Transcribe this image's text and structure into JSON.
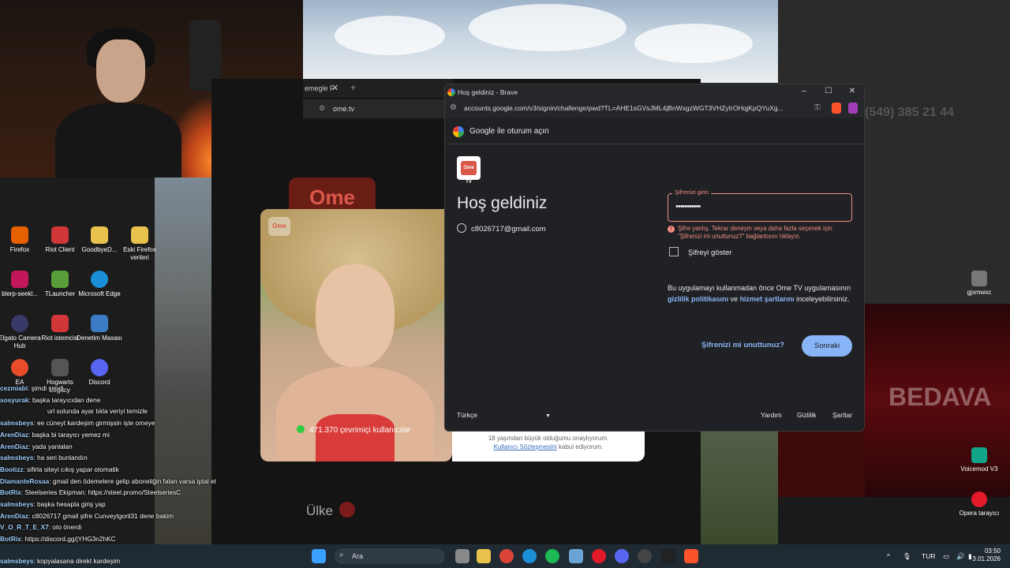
{
  "browser_window": {
    "title": "Hoş geldiniz - Brave",
    "url": "accounts.google.com/v3/signin/challenge/pwd?TL=AHE1sGVsJML4jBnWxgzWGT3VHZyIrOHqjKpQYuXg...",
    "header": "Google ile oturum açın"
  },
  "signin": {
    "app_badge": "Ome TV",
    "heading": "Hoş geldiniz",
    "account_email": "c8026717@gmail.com",
    "password_label": "Şifrenizi girin",
    "password_value": "•••••••••••",
    "error_text": "Şifre yanlış. Tekrar deneyin veya daha fazla seçenek için \"Şifrenizi mi unuttunuz?\" bağlantısını tıklayın.",
    "show_password_label": "Şifreyi göster",
    "policy_text_prefix": "Bu uygulamayı kullanmadan önce Ome TV uygulamasının",
    "privacy_link": "gizlilik politikasını",
    "and_word": "ve",
    "terms_link": "hizmet şartlarını",
    "policy_text_suffix": "inceleyebilirsiniz.",
    "forgot_link": "Şifrenizi mi unuttunuz?",
    "next_button": "Sonraki",
    "language": "Türkçe",
    "footer_help": "Yardım",
    "footer_privacy": "Gizlilik",
    "footer_terms": "Şartlar"
  },
  "ome_page": {
    "logo": "Ome",
    "tab_label": "emegle F",
    "url": "ome.tv",
    "online_count": "471.370 çevrimiçi kullanıcılar",
    "age_text": "18 yaşından büyük olduğumu onaylıyorum.",
    "agreement_link": "Kullanıcı Sözleşmesini",
    "agreement_suffix": "kabul ediyorum.",
    "country_label": "Ülke",
    "video_badge": "Ome"
  },
  "background_page": {
    "phone": "(549) 385 21 44"
  },
  "desktop_icons": [
    {
      "label": "Firefox",
      "color": "#e66000"
    },
    {
      "label": "Riot Client",
      "color": "#d13639"
    },
    {
      "label": "GoodbyeD...",
      "color": "#e8c24a"
    },
    {
      "label": "Eski Firefox verileri",
      "color": "#e8c24a"
    },
    {
      "label": "blerp-seekl...",
      "color": "#c2185b"
    },
    {
      "label": "TLauncher",
      "color": "#5a9e3a"
    },
    {
      "label": "Microsoft Edge",
      "color": "#1a8fd8"
    },
    {
      "label": "Elgato Camera Hub",
      "color": "#3a3a6a"
    },
    {
      "label": "Riot istemcisi",
      "color": "#d13639"
    },
    {
      "label": "Denetim Masası",
      "color": "#3b7dc4"
    },
    {
      "label": "EA",
      "color": "#e84c2b"
    },
    {
      "label": "Hogwarts Legacy",
      "color": "#555555"
    },
    {
      "label": "Discord",
      "color": "#5865f2"
    }
  ],
  "right_icons": [
    {
      "label": "gjxmwxc",
      "color": "#777777"
    },
    {
      "label": "Voicemod V3",
      "color": "#13a58a"
    },
    {
      "label": "Opera tarayıcı",
      "color": "#e21a2a"
    }
  ],
  "chat": [
    {
      "user": "cezmiabi",
      "msg": ": şimdi şimdi"
    },
    {
      "user": "sosyurak",
      "msg": ": başka tarayıcıdan dene"
    },
    {
      "user": "",
      "msg": "url solunda ayar tıkla veriyi temizle"
    },
    {
      "user": "salmsbeys",
      "msg": ": ee cüneyt kardeşim girmişsin işte omeye"
    },
    {
      "user": "ArenDiaz",
      "msg": ": başka bi tarayıcı yemez mi"
    },
    {
      "user": "ArenDiaz",
      "msg": ": yada yanlalan"
    },
    {
      "user": "salmsbeys",
      "msg": ": ha seri bunlandın"
    },
    {
      "user": "Bootizz",
      "msg": ": sifirla siteyi cıkış yapar otomatik"
    },
    {
      "user": "DiamanteRosaa",
      "msg": ": gmail den ödemelere gelip aboneliğin falan varsa iptal et"
    },
    {
      "user": "BotRix",
      "msg": ": Steelseries Ekipman: https://steel.promo/SteelseriesC"
    },
    {
      "user": "salmsbeys",
      "msg": ": başka hesapla giriş yap"
    },
    {
      "user": "ArenDiaz",
      "msg": ": c8026717 gmail şifre Cunveytgoril31 dene bakim"
    },
    {
      "user": "V_O_R_T_E_X7",
      "msg": ": oto önerdi"
    },
    {
      "user": "BotRix",
      "msg": ": https://discord.gg/jYHG3n2hKC"
    },
    {
      "user": "salmsbeys",
      "msg": ": kopyalasana direkt kardeşim"
    }
  ],
  "taskbar": {
    "search_placeholder": "Ara",
    "language": "TUR",
    "time": "03:50",
    "date": "3.01.2026",
    "icons": [
      "windows-start",
      "search",
      "widgets",
      "task-view",
      "file-explorer",
      "chrome",
      "edge",
      "spotify",
      "steam",
      "opera",
      "discord",
      "obs",
      "terminal",
      "brave"
    ]
  }
}
